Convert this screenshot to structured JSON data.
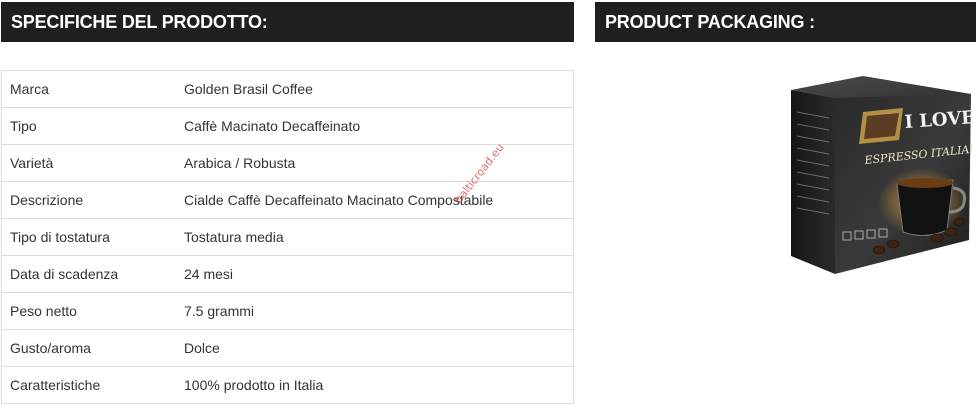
{
  "left_panel": {
    "title": "SPECIFICHE DEL PRODOTTO:",
    "rows": [
      {
        "label": "Marca",
        "value": "Golden Brasil Coffee"
      },
      {
        "label": "Tipo",
        "value": "Caffè Macinato Decaffeinato"
      },
      {
        "label": "Varietà",
        "value": "Arabica / Robusta"
      },
      {
        "label": "Descrizione",
        "value": "Cialde Caffè Decaffeinato Macinato Compostabile"
      },
      {
        "label": "Tipo di tostatura",
        "value": "Tostatura media"
      },
      {
        "label": "Data di scadenza",
        "value": "24 mesi"
      },
      {
        "label": "Peso netto",
        "value": "7.5 grammi"
      },
      {
        "label": "Gusto/aroma",
        "value": "Dolce"
      },
      {
        "label": "Caratteristiche",
        "value": "100% prodotto in Italia"
      }
    ]
  },
  "watermark": "balticroad.eu",
  "right_panel": {
    "title": "PRODUCT PACKAGING :",
    "box_brand_line1": "I LOVE",
    "box_brand_line2": "ESPRESSO ITALIANO"
  },
  "colors": {
    "header_bg": "#1f1f1f",
    "header_text": "#ffffff",
    "border": "#dcdcdc",
    "watermark": "#d9534f"
  }
}
